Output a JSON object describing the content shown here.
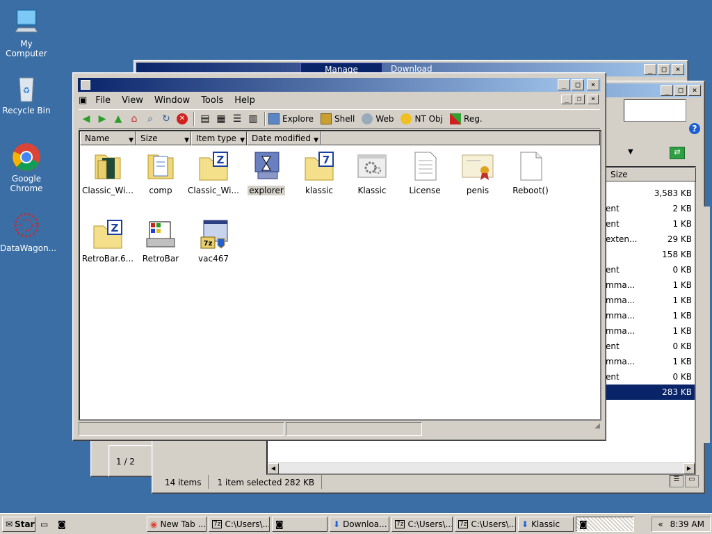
{
  "desktop": {
    "icons": [
      {
        "label": "My Computer"
      },
      {
        "label": "Recycle Bin"
      },
      {
        "label": "Google Chrome"
      },
      {
        "label": "DataWagon..."
      }
    ]
  },
  "back_window": {
    "tabs": [
      "Manage",
      "Download"
    ]
  },
  "right_window": {
    "size_header": "Size",
    "rows": [
      {
        "type": "",
        "size": "3,583 KB"
      },
      {
        "type": "ent",
        "size": "2 KB"
      },
      {
        "type": "ent",
        "size": "1 KB"
      },
      {
        "type": "exten...",
        "size": "29 KB"
      },
      {
        "type": "",
        "size": "158 KB"
      },
      {
        "type": "ent",
        "size": "0 KB"
      },
      {
        "type": "mma...",
        "size": "1 KB"
      },
      {
        "type": "mma...",
        "size": "1 KB"
      },
      {
        "type": "mma...",
        "size": "1 KB"
      },
      {
        "type": "mma...",
        "size": "1 KB"
      },
      {
        "type": "ent",
        "size": "0 KB"
      },
      {
        "type": "mma...",
        "size": "1 KB"
      },
      {
        "type": "ent",
        "size": "0 KB"
      },
      {
        "type": "",
        "size": "283 KB"
      }
    ],
    "status": {
      "count": "14 items",
      "selected": "1 item selected  282 KB"
    },
    "page_indicator": "1 / 2"
  },
  "main_window": {
    "menu": [
      "File",
      "View",
      "Window",
      "Tools",
      "Help"
    ],
    "toolbar": {
      "explore": "Explore",
      "shell": "Shell",
      "web": "Web",
      "ntobj": "NT Obj",
      "reg": "Reg."
    },
    "columns": [
      "Name",
      "Size",
      "Item type",
      "Date modified"
    ],
    "files": [
      {
        "label": "Classic_Wi...",
        "icon": "folder-dark-icon"
      },
      {
        "label": "comp",
        "icon": "folder-doc-icon"
      },
      {
        "label": "Classic_Wi...",
        "icon": "zip-folder-icon"
      },
      {
        "label": "explorer",
        "icon": "explorer-icon"
      },
      {
        "label": "klassic",
        "icon": "7z-folder-icon"
      },
      {
        "label": "Klassic",
        "icon": "settings-window-icon"
      },
      {
        "label": "License",
        "icon": "text-file-icon"
      },
      {
        "label": "penis",
        "icon": "certificate-icon"
      },
      {
        "label": "Reboot()",
        "icon": "blank-file-icon"
      },
      {
        "label": "RetroBar.6...",
        "icon": "zip-folder-icon"
      },
      {
        "label": "RetroBar",
        "icon": "retrobar-icon"
      },
      {
        "label": "vac467",
        "icon": "installer-icon"
      }
    ]
  },
  "taskbar": {
    "start": "Start",
    "buttons": [
      "New Tab ...",
      "C:\\Users\\...",
      "Downloa...",
      "C:\\Users\\...",
      "C:\\Users\\...",
      "Klassic"
    ],
    "time": "8:39 AM"
  },
  "colors": {
    "desktop": "#3a6ea5",
    "titlebar": "#0a246a",
    "selection": "#0a246a"
  }
}
